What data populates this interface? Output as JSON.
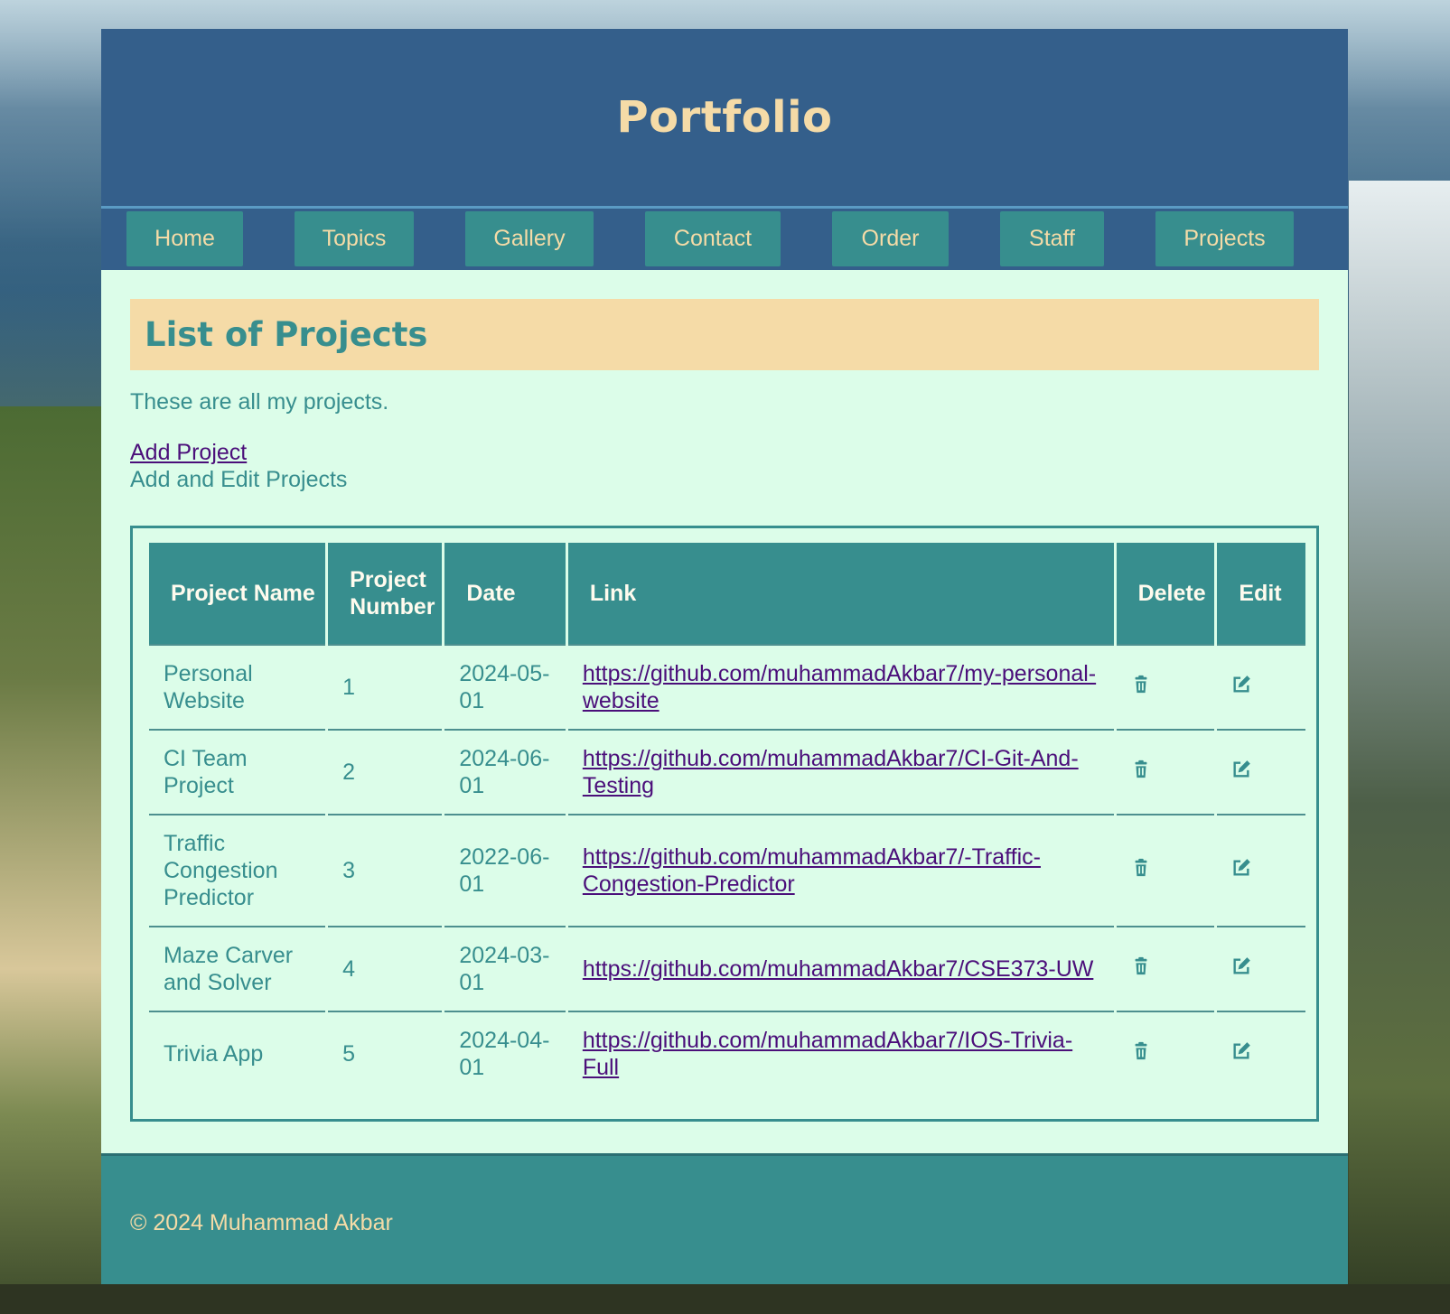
{
  "site": {
    "title": "Portfolio"
  },
  "nav": {
    "items": [
      {
        "label": "Home"
      },
      {
        "label": "Topics"
      },
      {
        "label": "Gallery"
      },
      {
        "label": "Contact"
      },
      {
        "label": "Order"
      },
      {
        "label": "Staff"
      },
      {
        "label": "Projects"
      }
    ]
  },
  "main": {
    "heading": "List of Projects",
    "intro": "These are all my projects.",
    "add_link": "Add Project",
    "subtitle": "Add and Edit Projects"
  },
  "table": {
    "headers": [
      "Project Name",
      "Project Number",
      "Date",
      "Link",
      "Delete",
      "Edit"
    ],
    "rows": [
      {
        "name": "Personal Website",
        "number": "1",
        "date": "2024-05-01",
        "link": "https://github.com/muhammadAkbar7/my-personal-website",
        "delete_icon": "trash-icon",
        "edit_icon": "edit-icon"
      },
      {
        "name": "CI Team Project",
        "number": "2",
        "date": "2024-06-01",
        "link": "https://github.com/muhammadAkbar7/CI-Git-And-Testing",
        "delete_icon": "trash-icon",
        "edit_icon": "edit-icon"
      },
      {
        "name": "Traffic Congestion Predictor",
        "number": "3",
        "date": "2022-06-01",
        "link": "https://github.com/muhammadAkbar7/-Traffic-Congestion-Predictor",
        "delete_icon": "trash-icon",
        "edit_icon": "edit-icon"
      },
      {
        "name": "Maze Carver and Solver",
        "number": "4",
        "date": "2024-03-01",
        "link": "https://github.com/muhammadAkbar7/CSE373-UW",
        "delete_icon": "trash-icon",
        "edit_icon": "edit-icon"
      },
      {
        "name": "Trivia App",
        "number": "5",
        "date": "2024-04-01",
        "link": "https://github.com/muhammadAkbar7/IOS-Trivia-Full",
        "delete_icon": "trash-icon",
        "edit_icon": "edit-icon"
      }
    ]
  },
  "footer": {
    "text": "© 2024 Muhammad Akbar"
  },
  "colors": {
    "header_bg": "#345f8b",
    "accent_teal": "#378e8e",
    "cream": "#f5dba7",
    "content_bg": "#dcfde9",
    "link_purple": "#4b0f7a"
  }
}
